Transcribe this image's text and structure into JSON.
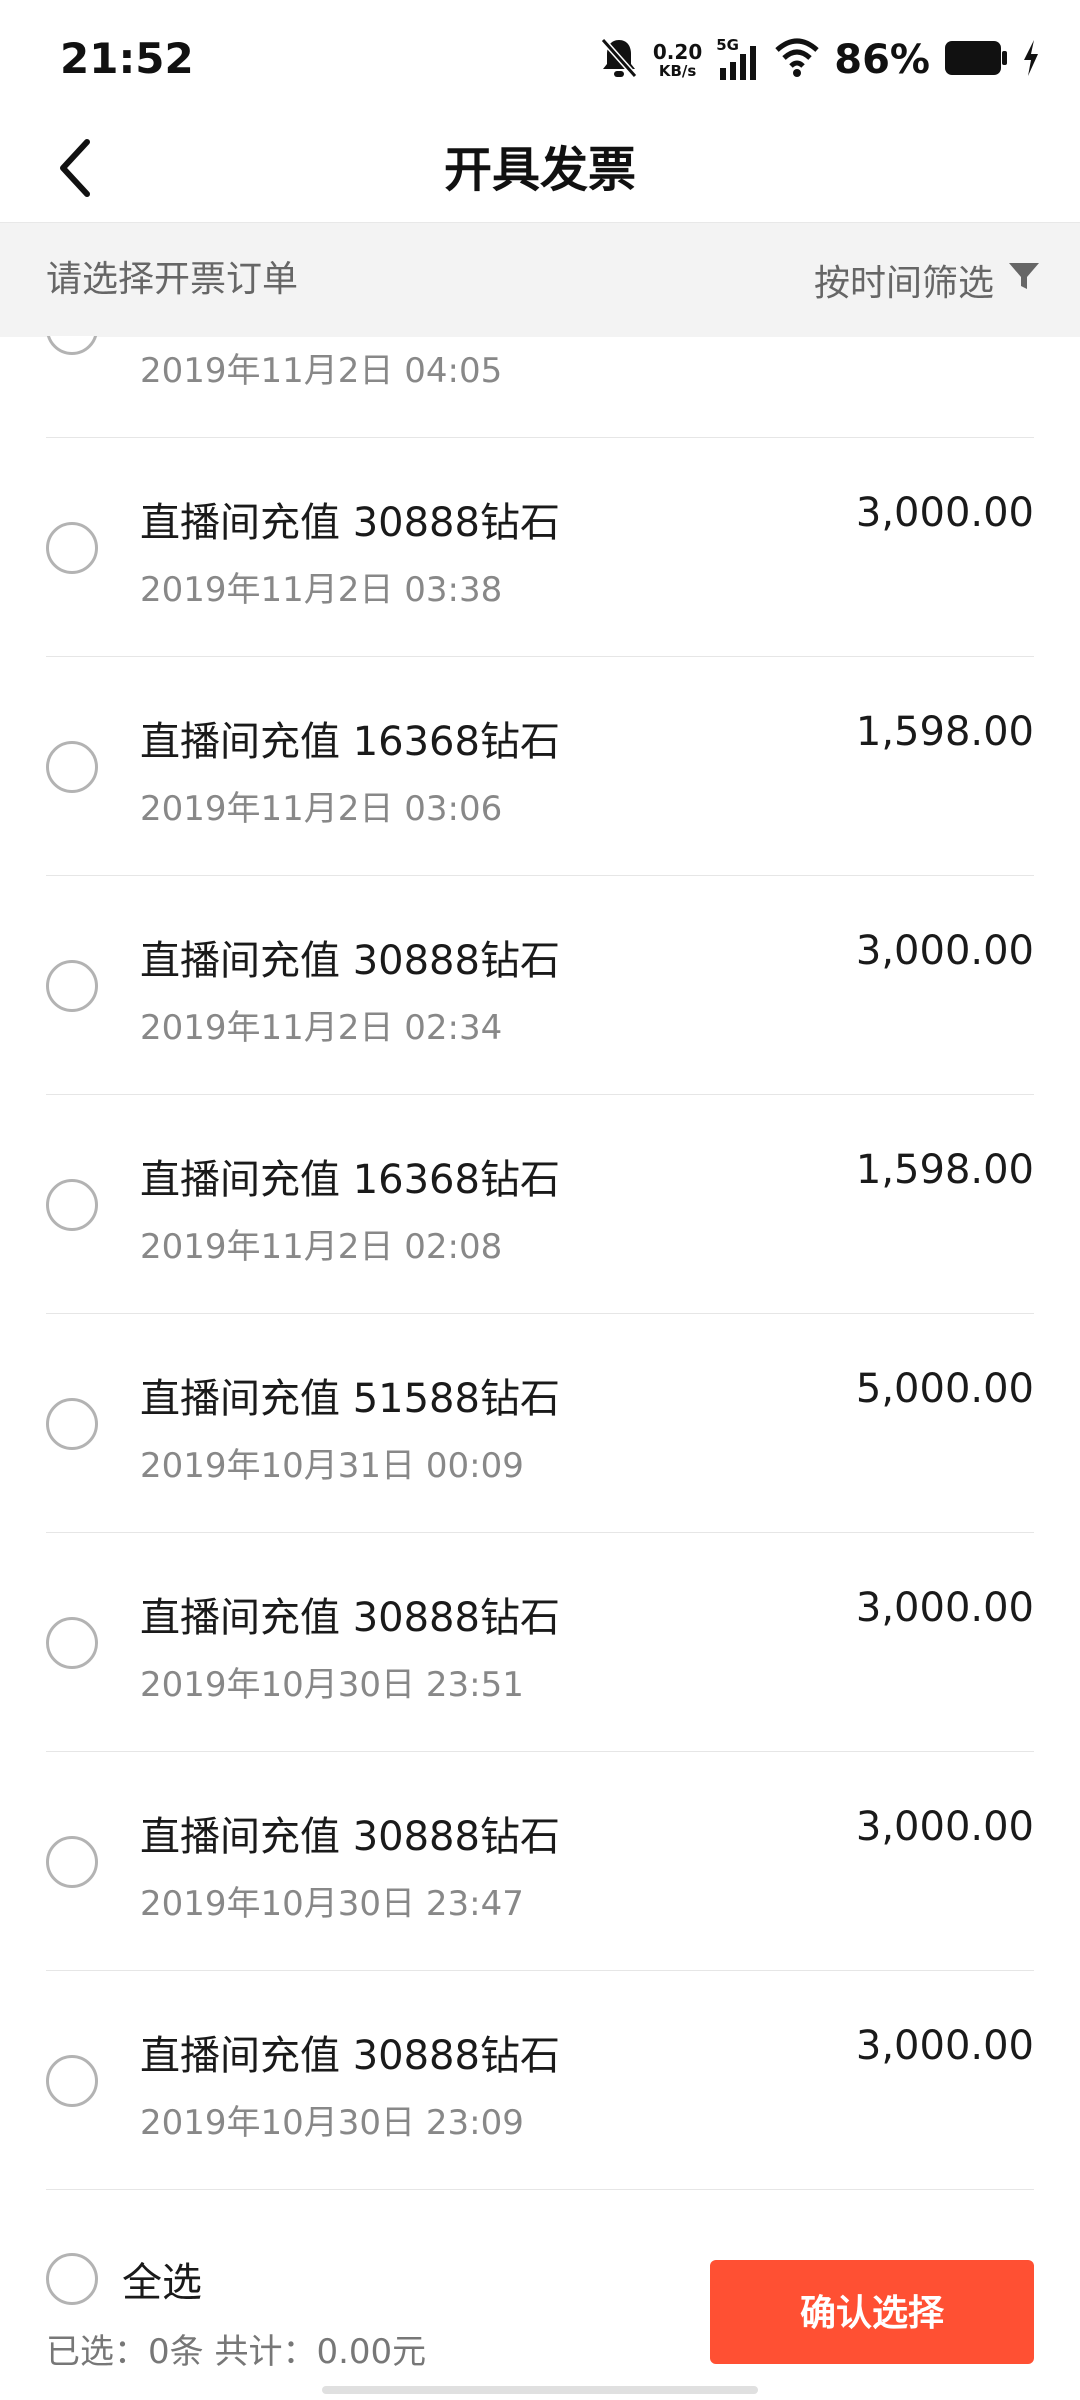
{
  "status_bar": {
    "time": "21:52",
    "net_speed_value": "0.20",
    "net_speed_unit": "KB/s",
    "network_type": "5G",
    "battery_percent": "86%",
    "icons": [
      "bell-muted-icon",
      "signal-icon",
      "wifi-icon",
      "battery-icon",
      "charging-icon"
    ]
  },
  "header": {
    "title": "开具发票",
    "back_icon": "chevron-left-icon"
  },
  "filter_bar": {
    "label": "请选择开票订单",
    "filter_label": "按时间筛选",
    "filter_icon": "funnel-icon"
  },
  "orders": [
    {
      "title": "",
      "time": "2019年11月2日 04:05",
      "amount": ""
    },
    {
      "title": "直播间充值 30888钻石",
      "time": "2019年11月2日 03:38",
      "amount": "3,000.00"
    },
    {
      "title": "直播间充值 16368钻石",
      "time": "2019年11月2日 03:06",
      "amount": "1,598.00"
    },
    {
      "title": "直播间充值 30888钻石",
      "time": "2019年11月2日 02:34",
      "amount": "3,000.00"
    },
    {
      "title": "直播间充值 16368钻石",
      "time": "2019年11月2日 02:08",
      "amount": "1,598.00"
    },
    {
      "title": "直播间充值 51588钻石",
      "time": "2019年10月31日 00:09",
      "amount": "5,000.00"
    },
    {
      "title": "直播间充值 30888钻石",
      "time": "2019年10月30日 23:51",
      "amount": "3,000.00"
    },
    {
      "title": "直播间充值 30888钻石",
      "time": "2019年10月30日 23:47",
      "amount": "3,000.00"
    },
    {
      "title": "直播间充值 30888钻石",
      "time": "2019年10月30日 23:09",
      "amount": "3,000.00"
    }
  ],
  "bottom_bar": {
    "select_all_label": "全选",
    "summary": "已选：0条 共计：0.00元",
    "confirm_label": "确认选择"
  },
  "colors": {
    "accent": "#ff5033",
    "filter_bg": "#f3f3f3",
    "radio_border": "#b3b3b3"
  }
}
